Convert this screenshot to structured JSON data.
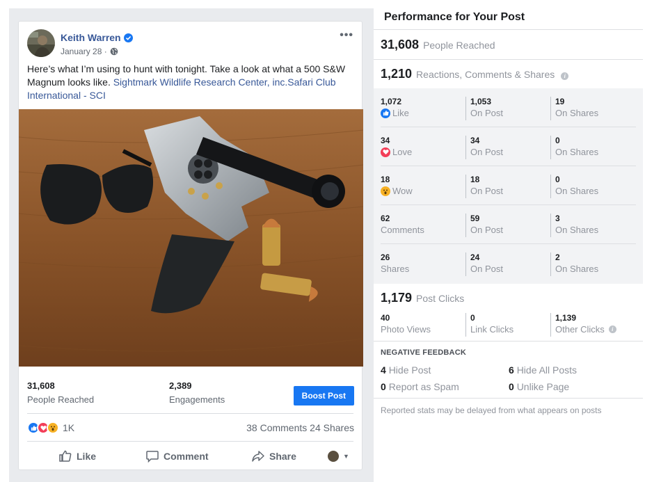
{
  "post": {
    "author": "Keith Warren",
    "date": "January 28 ·",
    "text_main": "Here’s what I’m using to hunt with tonight. Take a look at what a 500 S&W Magnum looks like. ",
    "mention_1": "Sightmark Wildlife Research Center, inc.",
    "mention_2": "Safari Club International - SCI",
    "reach_num": "31,608",
    "reach_label": "People Reached",
    "engagements_num": "2,389",
    "engagements_label": "Engagements",
    "boost_label": "Boost Post",
    "reaction_count": "1K",
    "comments_label": "38 Comments",
    "shares_label": "24 Shares",
    "actions": {
      "like": "Like",
      "comment": "Comment",
      "share": "Share"
    }
  },
  "panel": {
    "title": "Performance for Your Post",
    "people_reached_num": "31,608",
    "people_reached_label": "People Reached",
    "rcs_num": "1,210",
    "rcs_label": "Reactions, Comments & Shares",
    "rows": [
      {
        "total": "1,072",
        "label": "Like",
        "icon": "like-icon",
        "on_post": "1,053",
        "on_post_label": "On Post",
        "on_shares": "19",
        "on_shares_label": "On Shares"
      },
      {
        "total": "34",
        "label": "Love",
        "icon": "love-icon",
        "on_post": "34",
        "on_post_label": "On Post",
        "on_shares": "0",
        "on_shares_label": "On Shares"
      },
      {
        "total": "18",
        "label": "Wow",
        "icon": "wow-icon",
        "on_post": "18",
        "on_post_label": "On Post",
        "on_shares": "0",
        "on_shares_label": "On Shares"
      },
      {
        "total": "62",
        "label": "Comments",
        "icon": "",
        "on_post": "59",
        "on_post_label": "On Post",
        "on_shares": "3",
        "on_shares_label": "On Shares"
      },
      {
        "total": "26",
        "label": "Shares",
        "icon": "",
        "on_post": "24",
        "on_post_label": "On Post",
        "on_shares": "2",
        "on_shares_label": "On Shares"
      }
    ],
    "post_clicks_num": "1,179",
    "post_clicks_label": "Post Clicks",
    "clicks": [
      {
        "num": "40",
        "label": "Photo Views"
      },
      {
        "num": "0",
        "label": "Link Clicks"
      },
      {
        "num": "1,139",
        "label": "Other Clicks"
      }
    ],
    "negative_title": "NEGATIVE FEEDBACK",
    "negative": [
      {
        "num": "4",
        "label": "Hide Post"
      },
      {
        "num": "6",
        "label": "Hide All Posts"
      },
      {
        "num": "0",
        "label": "Report as Spam"
      },
      {
        "num": "0",
        "label": "Unlike Page"
      }
    ],
    "footnote": "Reported stats may be delayed from what appears on posts"
  },
  "colors": {
    "link": "#385898",
    "boost": "#1877f2",
    "like": "#1877f2",
    "love": "#f33e58",
    "wow": "#f7b125"
  }
}
